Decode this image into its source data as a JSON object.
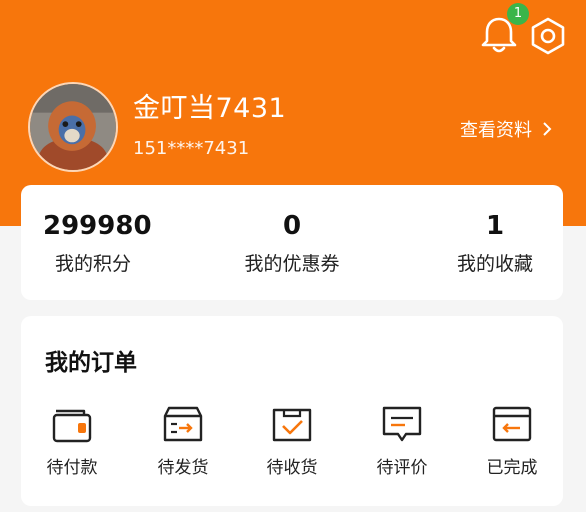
{
  "header": {
    "notification_count": "1",
    "username": "金叮当7431",
    "phone": "151****7431",
    "profile_link_label": "查看资料",
    "accent_color": "#f7760c"
  },
  "stats": [
    {
      "value": "299980",
      "label": "我的积分"
    },
    {
      "value": "0",
      "label": "我的优惠券"
    },
    {
      "value": "1",
      "label": "我的收藏"
    }
  ],
  "orders": {
    "title": "我的订单",
    "items": [
      {
        "label": "待付款",
        "icon": "wallet-icon"
      },
      {
        "label": "待发货",
        "icon": "box-arrow-icon"
      },
      {
        "label": "待收货",
        "icon": "box-check-icon"
      },
      {
        "label": "待评价",
        "icon": "comment-icon"
      },
      {
        "label": "已完成",
        "icon": "card-return-icon"
      }
    ]
  }
}
